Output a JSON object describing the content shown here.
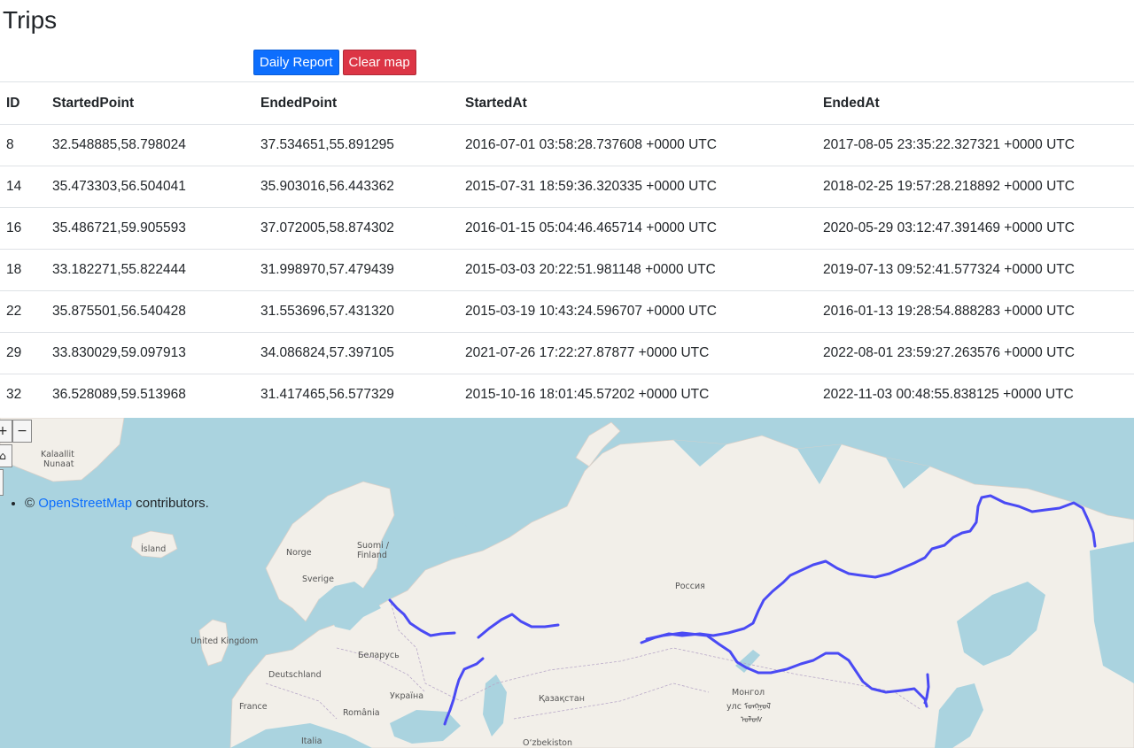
{
  "page": {
    "title": "Trips"
  },
  "toolbar": {
    "daily_report_label": "Daily Report",
    "clear_map_label": "Clear map"
  },
  "table": {
    "headers": [
      "ID",
      "StartedPoint",
      "EndedPoint",
      "StartedAt",
      "EndedAt"
    ],
    "rows": [
      [
        "8",
        "32.548885,58.798024",
        "37.534651,55.891295",
        "2016-07-01 03:58:28.737608 +0000 UTC",
        "2017-08-05 23:35:22.327321 +0000 UTC"
      ],
      [
        "14",
        "35.473303,56.504041",
        "35.903016,56.443362",
        "2015-07-31 18:59:36.320335 +0000 UTC",
        "2018-02-25 19:57:28.218892 +0000 UTC"
      ],
      [
        "16",
        "35.486721,59.905593",
        "37.072005,58.874302",
        "2016-01-15 05:04:46.465714 +0000 UTC",
        "2020-05-29 03:12:47.391469 +0000 UTC"
      ],
      [
        "18",
        "33.182271,55.822444",
        "31.998970,57.479439",
        "2015-03-03 20:22:51.981148 +0000 UTC",
        "2019-07-13 09:52:41.577324 +0000 UTC"
      ],
      [
        "22",
        "35.875501,56.540428",
        "31.553696,57.431320",
        "2015-03-19 10:43:24.596707 +0000 UTC",
        "2016-01-13 19:28:54.888283 +0000 UTC"
      ],
      [
        "29",
        "33.830029,59.097913",
        "34.086824,57.397105",
        "2021-07-26 17:22:27.87877 +0000 UTC",
        "2022-08-01 23:59:27.263576 +0000 UTC"
      ],
      [
        "32",
        "36.528089,59.513968",
        "31.417465,56.577329",
        "2015-10-16 18:01:45.57202 +0000 UTC",
        "2022-11-03 00:48:55.838125 +0000 UTC"
      ]
    ]
  },
  "map": {
    "zoom_in_label": "+",
    "zoom_out_label": "−",
    "home_icon": "home-icon",
    "attribution": {
      "prefix": "© ",
      "link_text": "OpenStreetMap",
      "suffix": " contributors."
    },
    "labels": {
      "greenland": "Kalaallit\nNunaat",
      "iceland": "Ísland",
      "norway": "Norge",
      "sweden": "Sverige",
      "finland_1": "Suomi /",
      "finland_2": "Finland",
      "russia": "Россия",
      "uk": "United Kingdom",
      "belarus": "Беларусь",
      "germany": "Deutschland",
      "ukraine": "Україна",
      "france": "France",
      "romania": "România",
      "kazakhstan": "Қазақстан",
      "mongolia_1": "Монгол",
      "mongolia_2": "улс ᠮᠣᠩᠭᠣᠯ",
      "mongolia_3": "ᠤᠯᠤᠰ",
      "italy": "Italia",
      "uzbekistan": "O‘zbekiston"
    },
    "colors": {
      "water": "#aad3df",
      "land": "#f2efe9",
      "route": "#4a4af4",
      "border": "#b8a8c8"
    }
  }
}
